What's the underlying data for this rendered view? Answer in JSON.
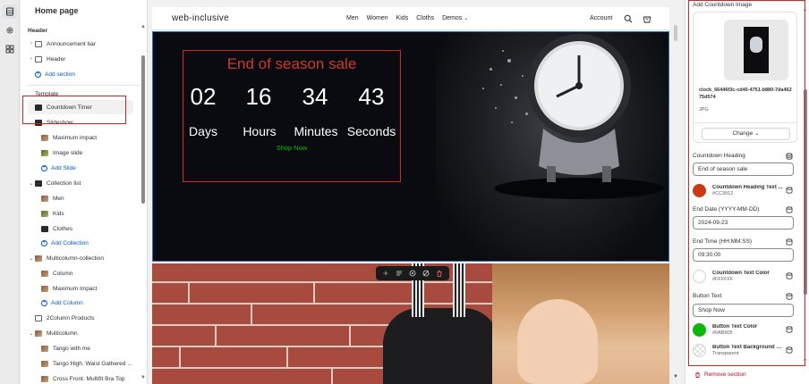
{
  "rail": {
    "icons": [
      "sections-icon",
      "gear-icon",
      "apps-icon"
    ]
  },
  "left": {
    "title": "Home page",
    "header_group": "Header",
    "announcement_bar": "Announcement bar",
    "header_item": "Header",
    "add_section": "Add section",
    "template_group": "Template",
    "countdown_timer": "Countdown Timer",
    "slideshow": "Slideshow",
    "maximum_impact": "Maximum impact",
    "image_slide": "Image slide",
    "add_slide": "Add Slide",
    "collection_list": "Collection list",
    "men": "Men",
    "kids": "Kids",
    "clothes": "Clothes",
    "add_collection": "Add Collection",
    "multicolumn_collection": "Multicolumn-collection",
    "column": "Column",
    "maximum_impact_2": "Maximum Impact",
    "add_column": "Add Column",
    "two_column_products": "2Column Products",
    "multicolumn": "Multicolumn",
    "tango_with_me": "Tango with me",
    "tango_high": "Tango High. Waist Gathered ...",
    "cross_front": "Cross Front. Multifit Bra Top"
  },
  "site": {
    "logo": "web-inclusive",
    "menu": [
      "Men",
      "Women",
      "Kids",
      "Cloths",
      "Demos"
    ],
    "account": "Account"
  },
  "countdown": {
    "heading": "End of season sale",
    "days": "02",
    "hours": "16",
    "minutes": "34",
    "seconds": "43",
    "days_label": "Days",
    "hours_label": "Hours",
    "minutes_label": "Minutes",
    "seconds_label": "Seconds",
    "button": "Shop Now"
  },
  "right": {
    "section_title": "Add Countdown Image",
    "file_name": "clock_66446f3c-cd40-4751-b880-7da46275d574",
    "file_type": "JPG",
    "change_label": "Change",
    "heading_label": "Countdown Heading",
    "heading_value": "End of season sale",
    "heading_color_name": "Countdown Heading Text ...",
    "heading_color_hex": "#CC3912",
    "end_date_label": "End Date (YYYY-MM-DD)",
    "end_date_value": "2024-09-23",
    "end_time_label": "End Time (HH:MM:SS)",
    "end_time_value": "09:30:00",
    "text_color_name": "Countdown Text Color",
    "text_color_hex": "#FFFFFF",
    "button_text_label": "Button Text",
    "button_text_value": "Shop Now",
    "button_color_name": "Button Text Color",
    "button_color_hex": "#0AB905",
    "button_bg_name": "Button Text Background C...",
    "button_bg_value": "Transparent",
    "remove_label": "Remove section"
  },
  "colors": {
    "heading": "#CC3912",
    "button": "#0AB905",
    "accent_blue": "#005bd3",
    "annotation_red": "#e02020"
  }
}
